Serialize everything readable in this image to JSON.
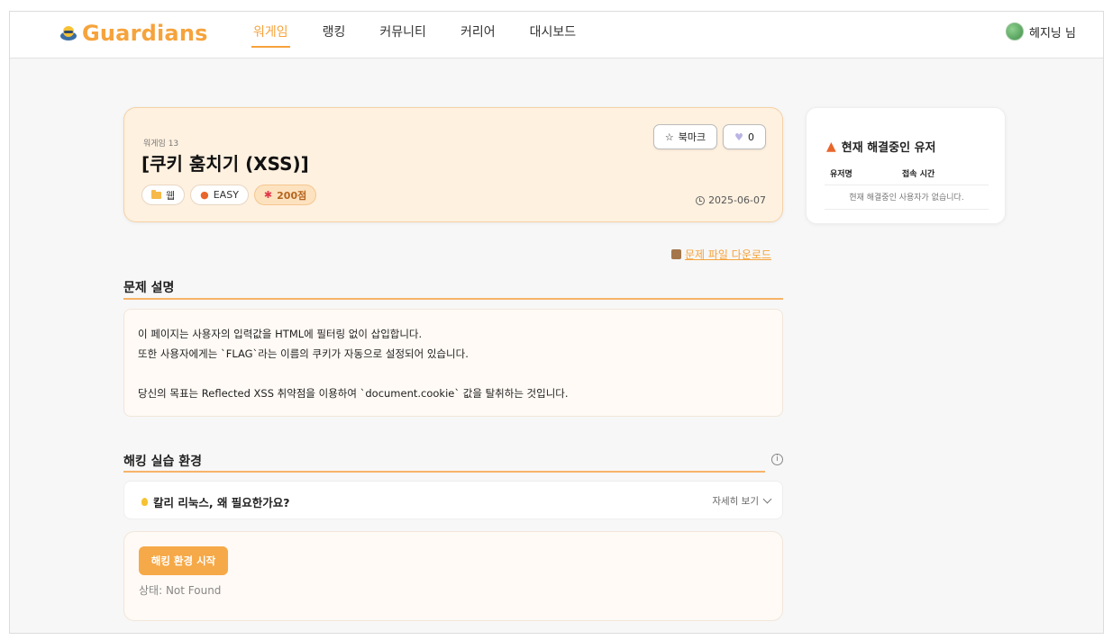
{
  "nav": {
    "logo": "Guardians",
    "menu": [
      "워게임",
      "랭킹",
      "커뮤니티",
      "커리어",
      "대시보드"
    ],
    "user": "헤지닝 님"
  },
  "challenge": {
    "number": "워게임 13",
    "title": "[쿠키 훔치기 (XSS)]",
    "category": "웹",
    "difficulty": "EASY",
    "points": "200점",
    "bookmark_label": "북마크",
    "like_count": "0",
    "date": "2025-06-07"
  },
  "side": {
    "title": "현재 해결중인 유저",
    "col_user": "유저명",
    "col_time": "접속 시간",
    "empty": "현재 해결중인 사용자가 없습니다."
  },
  "download_label": "문제 파일 다운로드",
  "description": {
    "heading": "문제 설명",
    "lines": [
      "이 페이지는 사용자의 입력값을 HTML에 필터링 없이 삽입합니다.",
      "또한 사용자에게는 `FLAG`라는 이름의 쿠키가 자동으로 설정되어 있습니다.",
      "",
      "당신의 목표는 Reflected XSS 취약점을 이용하여 `document.cookie` 값을 탈취하는 것입니다."
    ]
  },
  "lab": {
    "heading": "해킹 실습 환경",
    "kali_question": "칼리 리눅스, 왜 필요한가요?",
    "more_label": "자세히 보기",
    "start_label": "해킹 환경 시작",
    "status": "상태: Not Found"
  },
  "colors": {
    "accent": "#f6a33c"
  }
}
